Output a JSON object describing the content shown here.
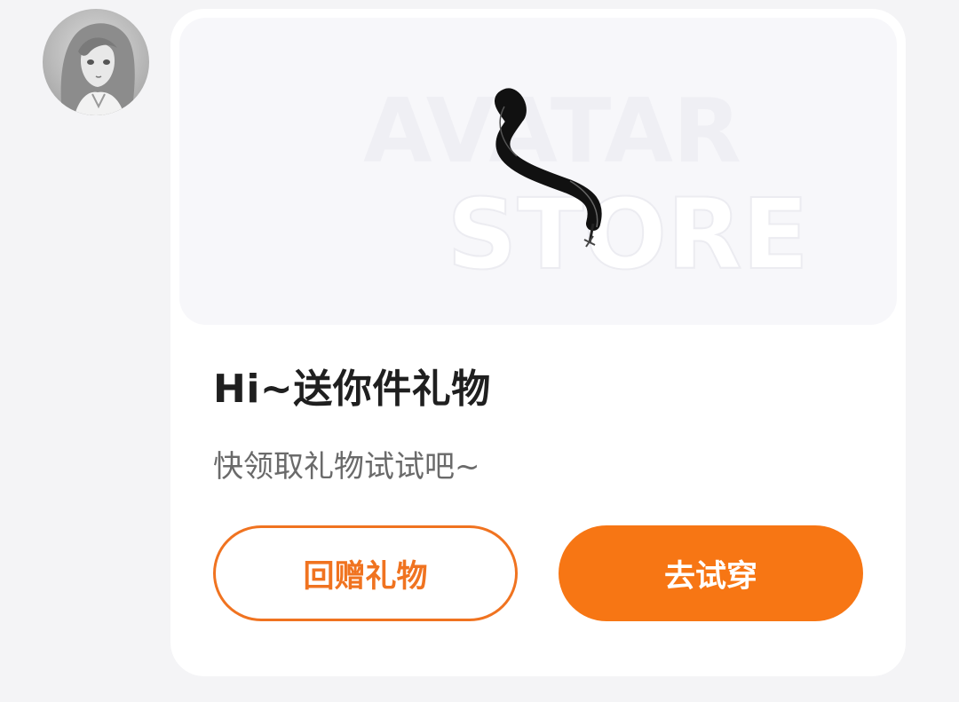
{
  "avatar": {
    "icon": "user-avatar"
  },
  "gift_card": {
    "image_watermark_line1": "AVATAR",
    "image_watermark_line2": "STORE",
    "title": "Hi~送你件礼物",
    "subtitle": "快领取礼物试试吧~",
    "return_gift_label": "回赠礼物",
    "try_on_label": "去试穿"
  },
  "colors": {
    "accent": "#f77614",
    "card_bg": "#ffffff",
    "page_bg": "#f4f4f6"
  }
}
